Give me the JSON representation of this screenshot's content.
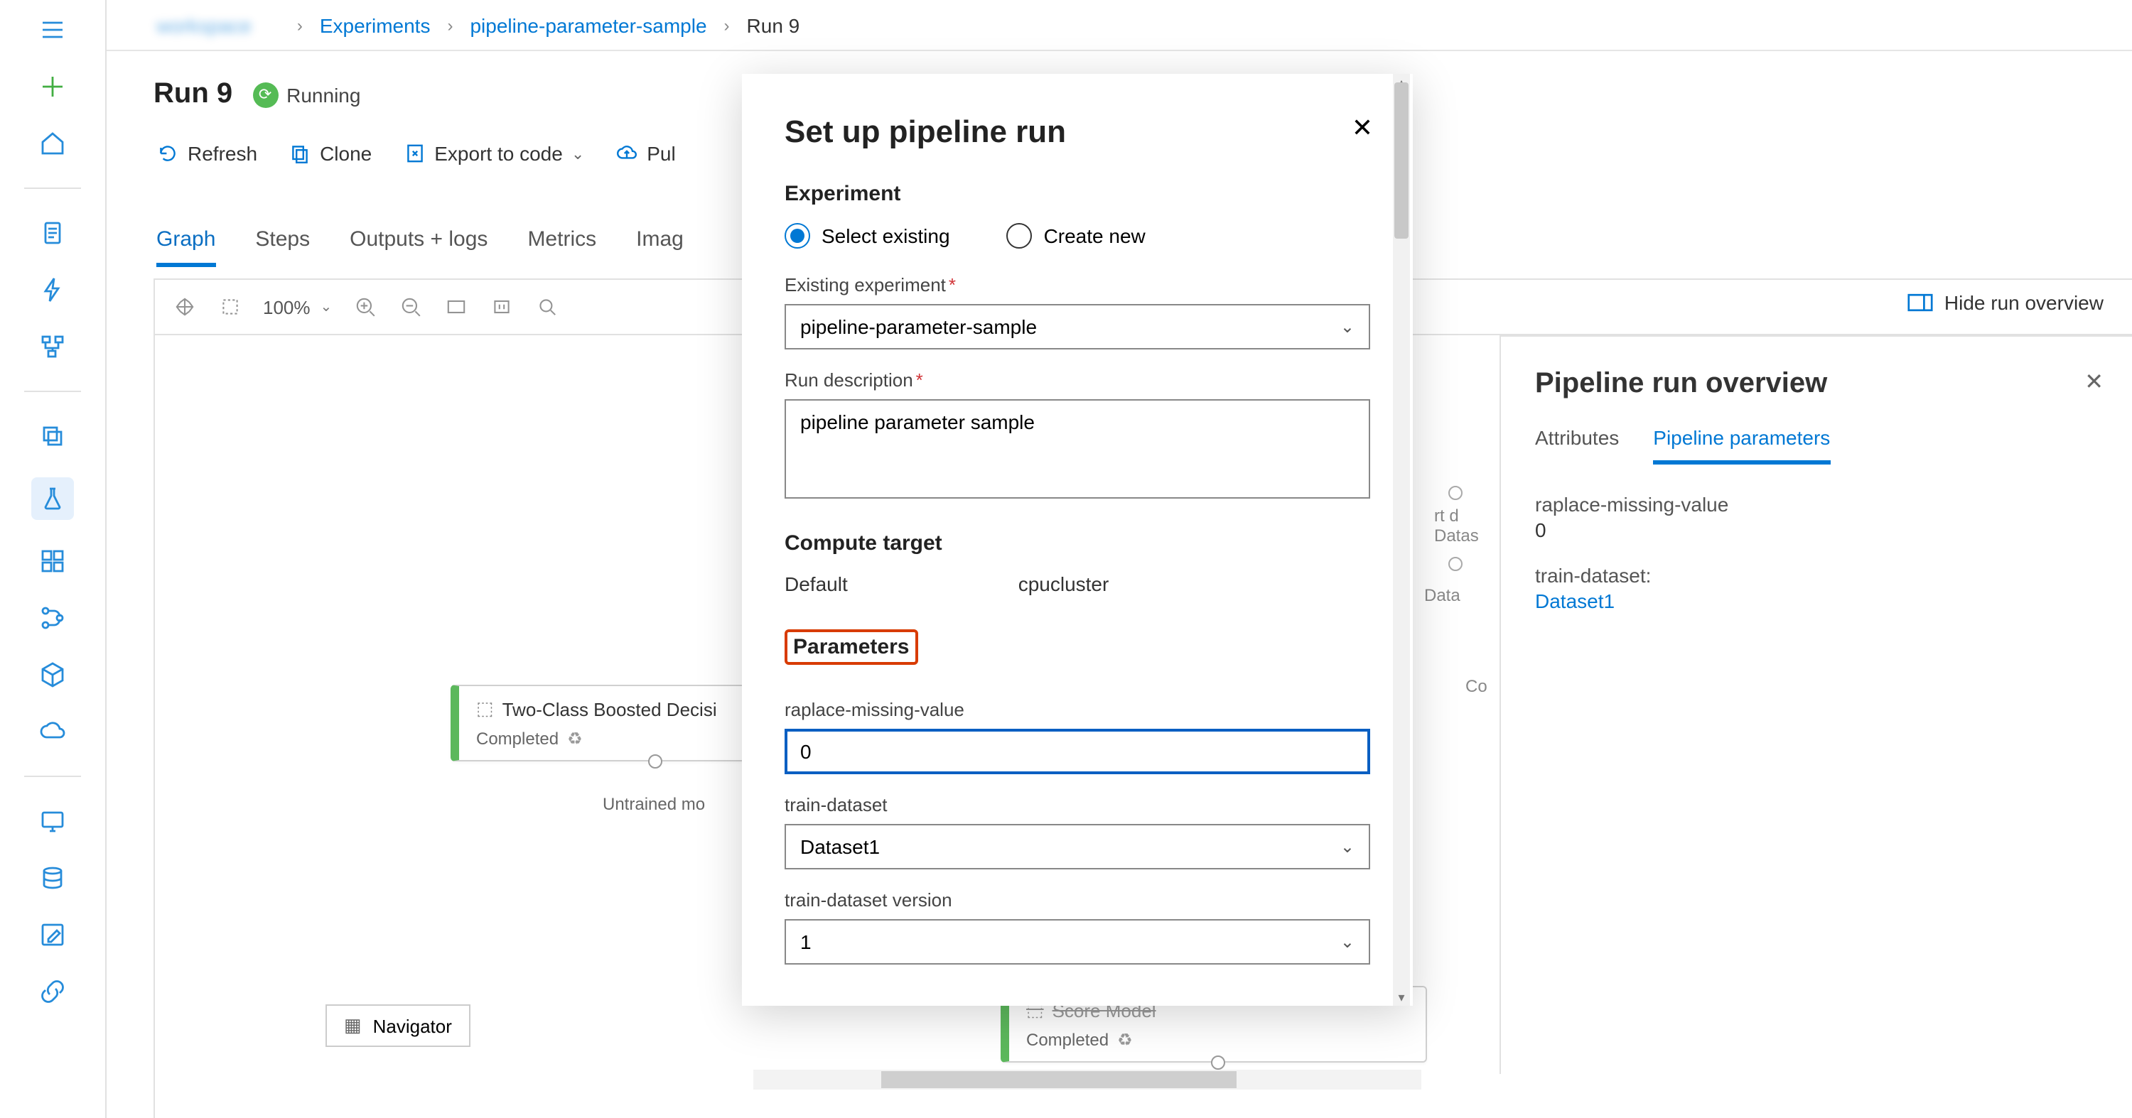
{
  "breadcrumb": {
    "workspace": "workspace",
    "experiments": "Experiments",
    "experiment": "pipeline-parameter-sample",
    "run": "Run 9"
  },
  "title": {
    "run": "Run 9",
    "status": "Running"
  },
  "toolbar": {
    "refresh": "Refresh",
    "clone": "Clone",
    "export": "Export to code",
    "publish": "Pul"
  },
  "tabs": {
    "graph": "Graph",
    "steps": "Steps",
    "outputs": "Outputs + logs",
    "metrics": "Metrics",
    "images": "Imag"
  },
  "graphbar": {
    "zoom": "100%"
  },
  "hide_overview": "Hide run overview",
  "overview": {
    "title": "Pipeline run overview",
    "tabs": {
      "attributes": "Attributes",
      "params": "Pipeline parameters"
    },
    "params": [
      {
        "name": "raplace-missing-value",
        "value": "0"
      },
      {
        "name": "train-dataset:",
        "value": "Dataset1",
        "is_link": true
      }
    ]
  },
  "dialog": {
    "title": "Set up pipeline run",
    "experiment_section": "Experiment",
    "radio_existing": "Select existing",
    "radio_new": "Create new",
    "existing_label": "Existing experiment",
    "existing_value": "pipeline-parameter-sample",
    "desc_label": "Run description",
    "desc_value": "pipeline parameter sample",
    "compute_section": "Compute target",
    "compute_default_label": "Default",
    "compute_default_value": "cpucluster",
    "params_section": "Parameters",
    "param1_label": "raplace-missing-value",
    "param1_value": "0",
    "param2_label": "train-dataset",
    "param2_value": "Dataset1",
    "param3_label": "train-dataset version",
    "param3_value": "1"
  },
  "nodes": {
    "node1_title": "Two-Class Boosted Decisi",
    "node1_status": "Completed",
    "node1_portlabel": "Untrained mo",
    "node2_title": "Score Model",
    "node2_status": "Completed",
    "bg_label1": "rt d",
    "bg_label2": "Datas",
    "bg_label3": "Data",
    "bg_label4": "Co"
  },
  "navigator": "Navigator"
}
